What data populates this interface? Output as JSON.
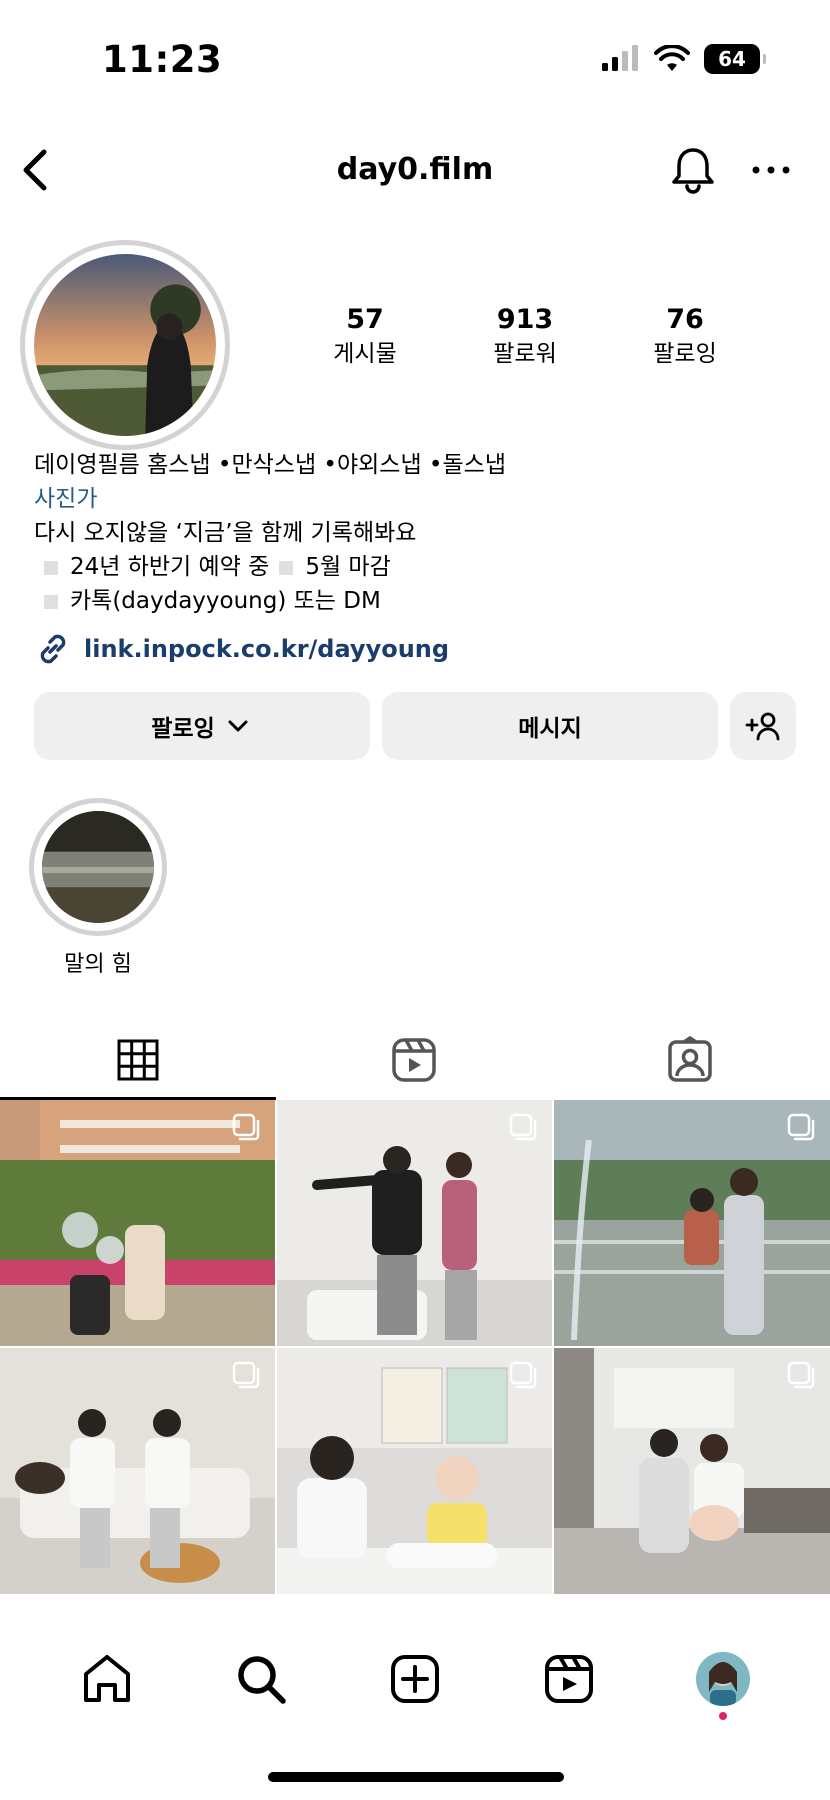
{
  "status_bar": {
    "time": "11:23",
    "battery": "64"
  },
  "header": {
    "username": "day0.film"
  },
  "profile": {
    "stats": [
      {
        "value": "57",
        "label": "게시물"
      },
      {
        "value": "913",
        "label": "팔로워"
      },
      {
        "value": "76",
        "label": "팔로잉"
      }
    ],
    "bio_name": "데이영필름 홈스냅 •만삭스냅 •야외스냅 •돌스냅",
    "bio_category": "사진가",
    "bio_line1": "다시 오지않을 ‘지금’을 함께 기록해봐요",
    "bio_line2a": "24년 하반기 예약 중",
    "bio_line2b": "5월 마감",
    "bio_line3": "카톡(daydayyoung) 또는 DM",
    "link": "link.inpock.co.kr/dayyoung"
  },
  "actions": {
    "follow": "팔로잉",
    "message": "메시지"
  },
  "highlights": [
    {
      "label": "말의 힘"
    }
  ],
  "tabs": [
    {
      "icon": "grid-icon",
      "active": true
    },
    {
      "icon": "reels-icon",
      "active": false
    },
    {
      "icon": "tagged-icon",
      "active": false
    }
  ],
  "grid_posts": [
    {
      "scene": "outdoor-bubbles"
    },
    {
      "scene": "couple-maternity-living-room"
    },
    {
      "scene": "fountain-mother-child"
    },
    {
      "scene": "family-with-dogs"
    },
    {
      "scene": "mother-baby-highchair"
    },
    {
      "scene": "couple-kitchen"
    }
  ],
  "bottom_nav": [
    "home-icon",
    "search-icon",
    "create-icon",
    "reels-icon",
    "profile-avatar"
  ],
  "colors": {
    "link": "#1b3d6d",
    "category": "#2a5a8a",
    "button_bg": "#efefef",
    "notification_dot": "#e0245e"
  }
}
